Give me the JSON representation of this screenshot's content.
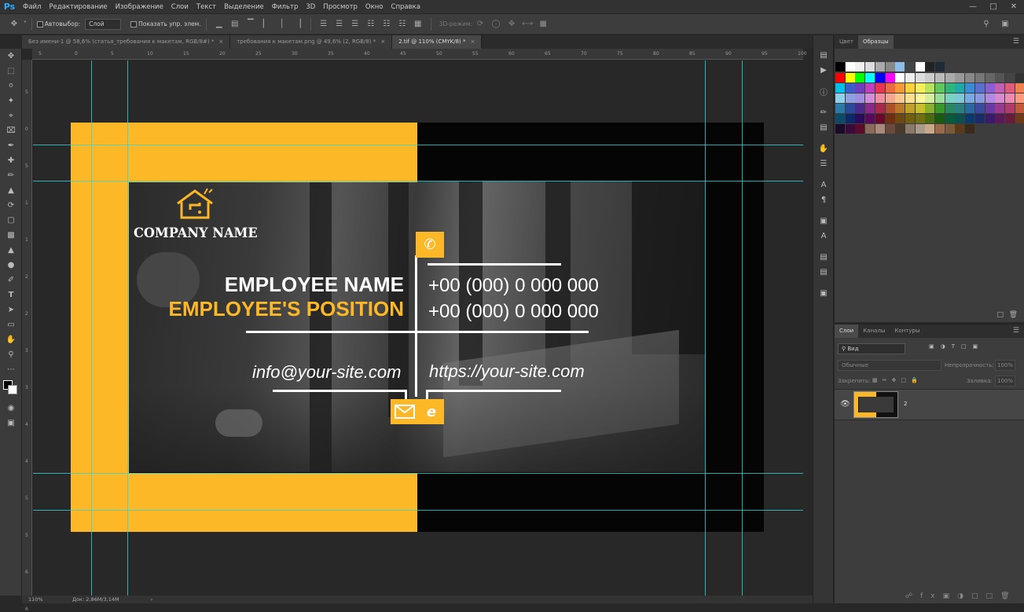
{
  "app": {
    "logo": "Ps"
  },
  "menu": [
    "Файл",
    "Редактирование",
    "Изображение",
    "Слои",
    "Текст",
    "Выделение",
    "Фильтр",
    "3D",
    "Просмотр",
    "Окно",
    "Справка"
  ],
  "options": {
    "autoselect_label": "Автовыбор:",
    "autoselect_value": "Слой",
    "show_controls_label": "Показать упр. элем.",
    "mode_3d_label": "3D-режим:"
  },
  "tabs": [
    {
      "label": "Без имени-1 @ 58,6% (статья_требования к макетам, RGB/8#) *",
      "active": false
    },
    {
      "label": "требования к макетам.png @ 49,6% (2, RGB/8) *",
      "active": false
    },
    {
      "label": "2.tif @ 110% (CMYK/8) *",
      "active": true
    }
  ],
  "ruler_top": [
    "5",
    "0",
    "5",
    "10",
    "15",
    "20",
    "25",
    "30",
    "35",
    "40",
    "45",
    "50",
    "55",
    "60",
    "65",
    "70",
    "75",
    "80",
    "85",
    "90",
    "95",
    "100"
  ],
  "ruler_left": [
    "5",
    "0",
    "5",
    "1",
    "1",
    "2",
    "2",
    "3",
    "3",
    "4",
    "4",
    "5",
    "5",
    "6",
    "6"
  ],
  "card": {
    "company": "COMPANY NAME",
    "employee_name": "EMPLOYEE NAME",
    "employee_position": "EMPLOYEE'S POSITION",
    "phone1": "+00 (000) 0 000 000",
    "phone2": "+00 (000) 0 000 000",
    "email": "info@your-site.com",
    "website": "https://your-site.com",
    "yellow": "#fcb827"
  },
  "status": {
    "zoom": "110%",
    "doc": "Док: 2,86M/3,14M"
  },
  "swatches_panel": {
    "tabs": [
      "Цвет",
      "Образцы"
    ],
    "active": "Образцы"
  },
  "layers_panel": {
    "tabs": [
      "Слои",
      "Каналы",
      "Контуры"
    ],
    "filter_value": "Вид",
    "blend_mode": "Обычные",
    "opacity_label": "Непрозрачность:",
    "opacity_value": "100%",
    "lock_label": "Закрепить:",
    "fill_label": "Заливка:",
    "fill_value": "100%",
    "layers": [
      {
        "name": "2",
        "visible": true
      }
    ]
  },
  "icons": [
    "move-tool-icon",
    "marquee-icon",
    "lasso-icon",
    "magic-wand-icon",
    "crop-icon",
    "eyedropper-icon",
    "heal-icon",
    "brush-icon",
    "stamp-icon",
    "history-brush-icon",
    "eraser-icon",
    "gradient-icon",
    "blur-icon",
    "dodge-icon",
    "pen-icon",
    "type-icon",
    "path-select-icon",
    "shape-icon",
    "hand-icon",
    "zoom-icon"
  ]
}
